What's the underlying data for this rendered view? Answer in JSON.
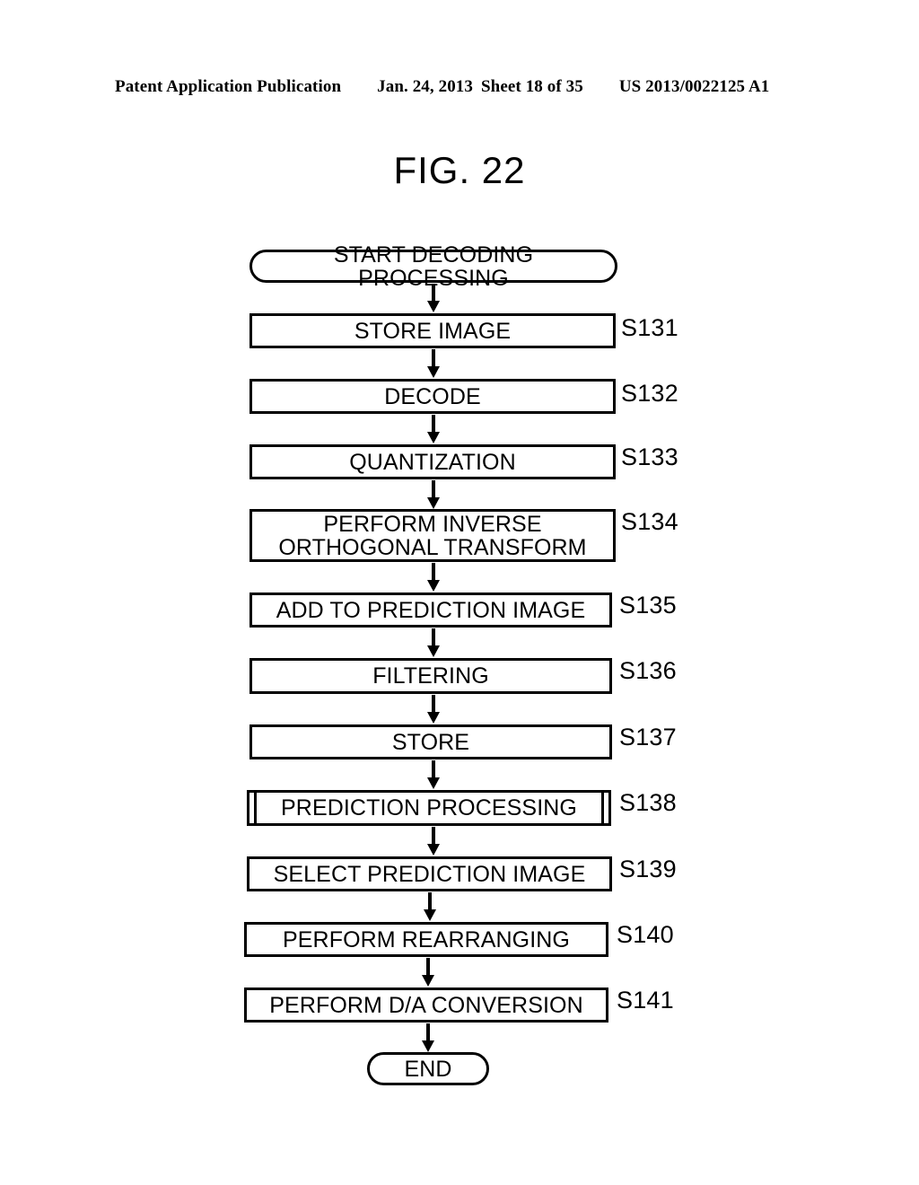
{
  "header": {
    "publication": "Patent Application Publication",
    "date": "Jan. 24, 2013",
    "sheet": "Sheet 18 of 35",
    "doc_number": "US 2013/0022125 A1"
  },
  "figure": {
    "title": "FIG. 22"
  },
  "flowchart": {
    "type": "flowchart",
    "orientation": "top-to-bottom",
    "nodes": [
      {
        "id": "start",
        "shape": "terminator",
        "label": "START DECODING PROCESSING",
        "step": ""
      },
      {
        "id": "s131",
        "shape": "process",
        "label": "STORE IMAGE",
        "step": "S131"
      },
      {
        "id": "s132",
        "shape": "process",
        "label": "DECODE",
        "step": "S132"
      },
      {
        "id": "s133",
        "shape": "process",
        "label": "QUANTIZATION",
        "step": "S133"
      },
      {
        "id": "s134",
        "shape": "process",
        "label": "PERFORM INVERSE ORTHOGONAL TRANSFORM",
        "step": "S134"
      },
      {
        "id": "s135",
        "shape": "process",
        "label": "ADD TO PREDICTION IMAGE",
        "step": "S135"
      },
      {
        "id": "s136",
        "shape": "process",
        "label": "FILTERING",
        "step": "S136"
      },
      {
        "id": "s137",
        "shape": "process",
        "label": "STORE",
        "step": "S137"
      },
      {
        "id": "s138",
        "shape": "subroutine",
        "label": "PREDICTION PROCESSING",
        "step": "S138"
      },
      {
        "id": "s139",
        "shape": "process",
        "label": "SELECT PREDICTION IMAGE",
        "step": "S139"
      },
      {
        "id": "s140",
        "shape": "process",
        "label": "PERFORM REARRANGING",
        "step": "S140"
      },
      {
        "id": "s141",
        "shape": "process",
        "label": "PERFORM D/A CONVERSION",
        "step": "S141"
      },
      {
        "id": "end",
        "shape": "terminator",
        "label": "END",
        "step": ""
      }
    ],
    "edges": [
      {
        "from": "start",
        "to": "s131"
      },
      {
        "from": "s131",
        "to": "s132"
      },
      {
        "from": "s132",
        "to": "s133"
      },
      {
        "from": "s133",
        "to": "s134"
      },
      {
        "from": "s134",
        "to": "s135"
      },
      {
        "from": "s135",
        "to": "s136"
      },
      {
        "from": "s136",
        "to": "s137"
      },
      {
        "from": "s137",
        "to": "s138"
      },
      {
        "from": "s138",
        "to": "s139"
      },
      {
        "from": "s139",
        "to": "s140"
      },
      {
        "from": "s140",
        "to": "s141"
      },
      {
        "from": "s141",
        "to": "end"
      }
    ]
  }
}
